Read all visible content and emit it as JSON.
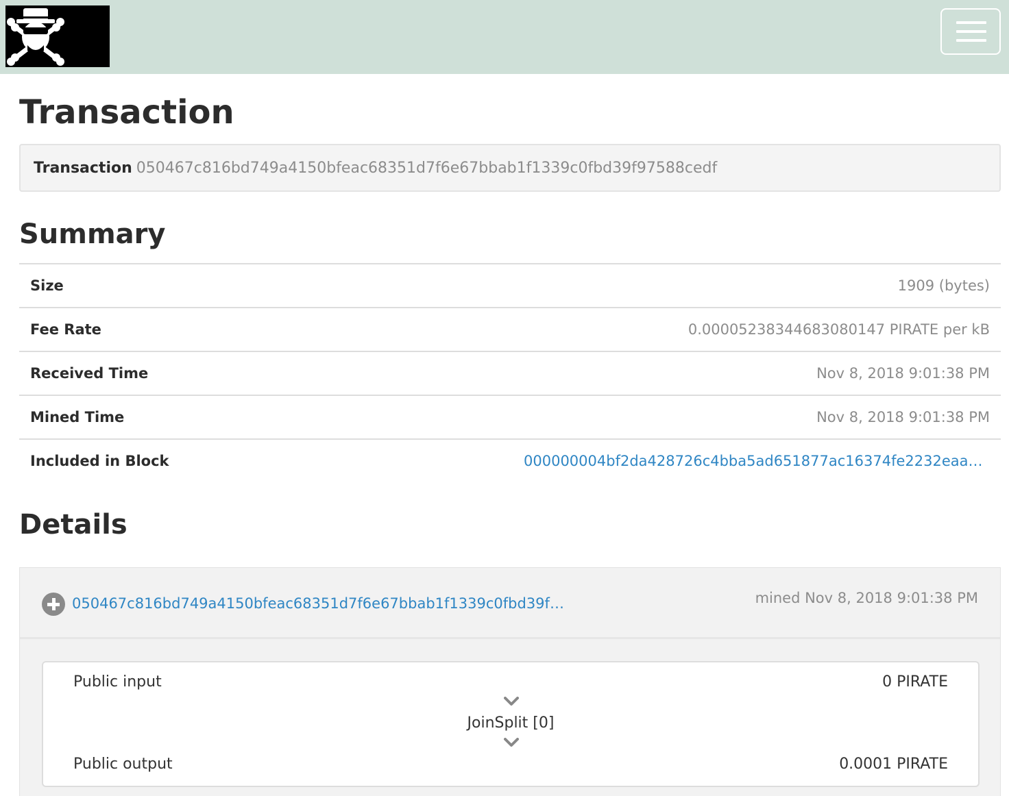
{
  "navbar": {
    "logo_alt": "pirate skull logo",
    "menu_icon": "hamburger-menu-icon"
  },
  "page": {
    "title": "Transaction"
  },
  "transaction": {
    "label": "Transaction",
    "hash": "050467c816bd749a4150bfeac68351d7f6e67bbab1f1339c0fbd39f97588cedf"
  },
  "summary": {
    "heading": "Summary",
    "rows": [
      {
        "key": "Size",
        "value": "1909 (bytes)"
      },
      {
        "key": "Fee Rate",
        "value": "0.00005238344683080147 PIRATE per kB"
      },
      {
        "key": "Received Time",
        "value": "Nov 8, 2018 9:01:38 PM"
      },
      {
        "key": "Mined Time",
        "value": "Nov 8, 2018 9:01:38 PM"
      },
      {
        "key": "Included in Block",
        "value": "000000004bf2da428726c4bba5ad651877ac16374fe2232eaaae86..."
      }
    ]
  },
  "details": {
    "heading": "Details",
    "txid": "050467c816bd749a4150bfeac68351d7f6e67bbab1f1339c0fbd39f975...",
    "mined_label": "mined Nov 8, 2018 9:01:38 PM",
    "joinsplit": {
      "public_input_label": "Public input",
      "public_input_value": "0 PIRATE",
      "name": "JoinSplit [0]",
      "public_output_label": "Public output",
      "public_output_value": "0.0001 PIRATE"
    }
  },
  "colors": {
    "navbar_bg": "#cfe0d8",
    "link": "#2f86c4",
    "muted": "#8c8c8c"
  }
}
